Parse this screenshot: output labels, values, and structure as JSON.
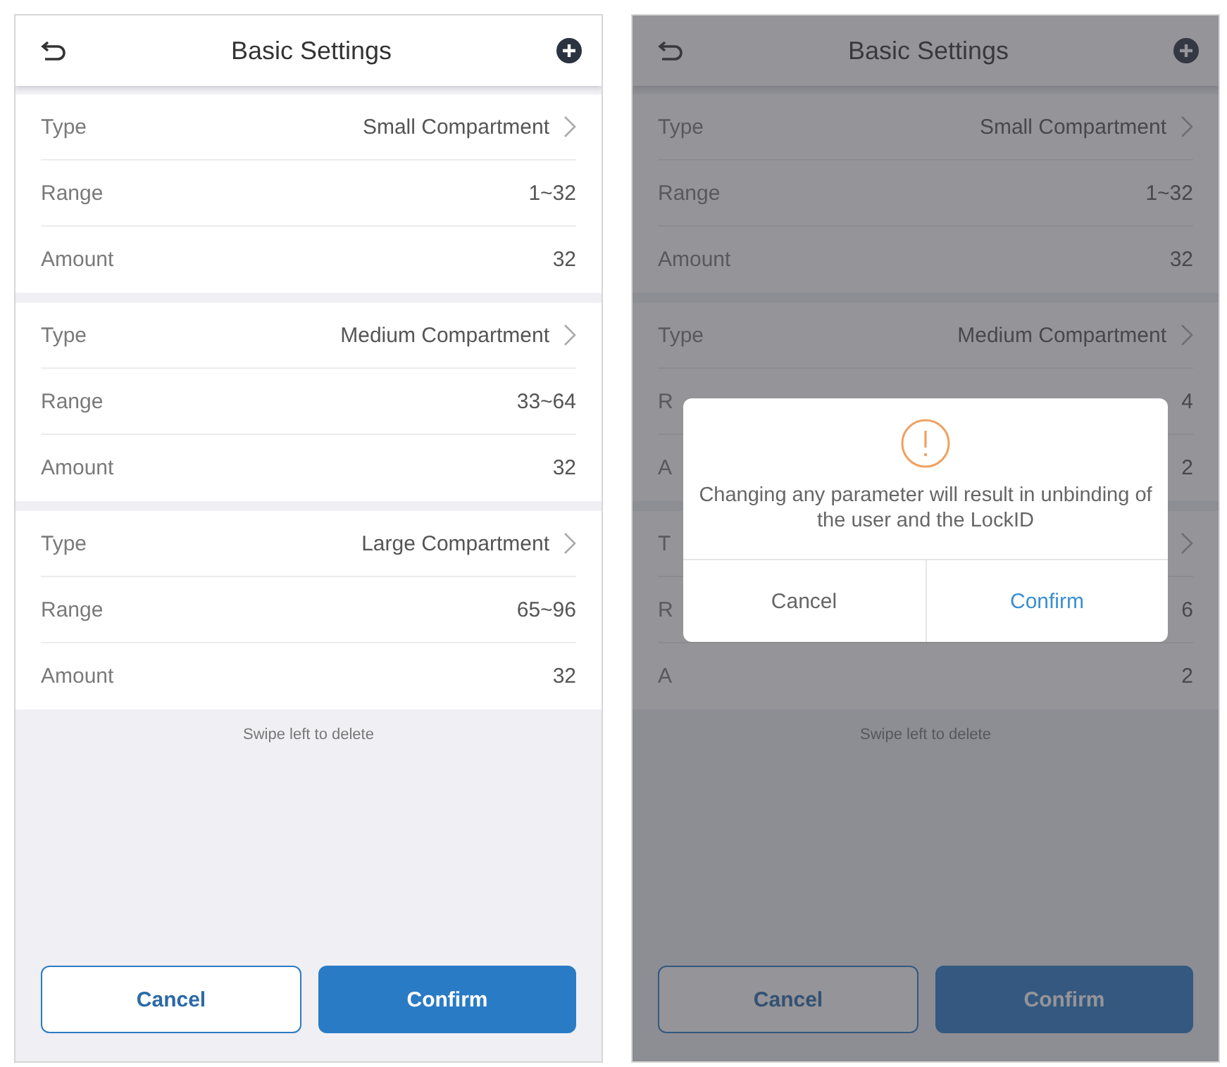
{
  "screens": [
    {
      "title": "Basic Settings",
      "sections": [
        {
          "rows": [
            {
              "label": "Type",
              "value": "Small Compartment",
              "chevron": true
            },
            {
              "label": "Range",
              "value": "1~32",
              "chevron": false
            },
            {
              "label": "Amount",
              "value": "32",
              "chevron": false
            }
          ]
        },
        {
          "rows": [
            {
              "label": "Type",
              "value": "Medium Compartment",
              "chevron": true
            },
            {
              "label": "Range",
              "value": "33~64",
              "chevron": false
            },
            {
              "label": "Amount",
              "value": "32",
              "chevron": false
            }
          ]
        },
        {
          "rows": [
            {
              "label": "Type",
              "value": "Large Compartment",
              "chevron": true
            },
            {
              "label": "Range",
              "value": "65~96",
              "chevron": false
            },
            {
              "label": "Amount",
              "value": "32",
              "chevron": false
            }
          ]
        }
      ],
      "hint": "Swipe left to delete",
      "buttons": [
        {
          "label": "Cancel",
          "kind": "outline"
        },
        {
          "label": "Confirm",
          "kind": "primary"
        }
      ]
    },
    {
      "title": "Basic Settings",
      "sections": [
        {
          "rows": [
            {
              "label": "Type",
              "value": "Small Compartment",
              "chevron": true
            },
            {
              "label": "Range",
              "value": "1~32",
              "chevron": false
            },
            {
              "label": "Amount",
              "value": "32",
              "chevron": false
            }
          ]
        },
        {
          "rows": [
            {
              "label": "Type",
              "value": "Medium Compartment",
              "chevron": true
            },
            {
              "label": "R",
              "value": "4",
              "chevron": false
            },
            {
              "label": "A",
              "value": "2",
              "chevron": false
            }
          ]
        },
        {
          "rows": [
            {
              "label": "T",
              "chevron": true
            },
            {
              "label": "R",
              "value": "6",
              "chevron": false
            },
            {
              "label": "A",
              "value": "2",
              "chevron": false
            }
          ]
        }
      ],
      "hint": "Swipe left to delete",
      "buttons": [
        {
          "label": "Cancel",
          "kind": "outline"
        },
        {
          "label": "Confirm",
          "kind": "primary"
        }
      ],
      "dialog": {
        "message": "Changing any parameter will result in unbinding of the user and the LockID",
        "buttons": [
          {
            "label": "Cancel",
            "kind": "plain"
          },
          {
            "label": "Confirm",
            "kind": "accent"
          }
        ]
      }
    }
  ]
}
